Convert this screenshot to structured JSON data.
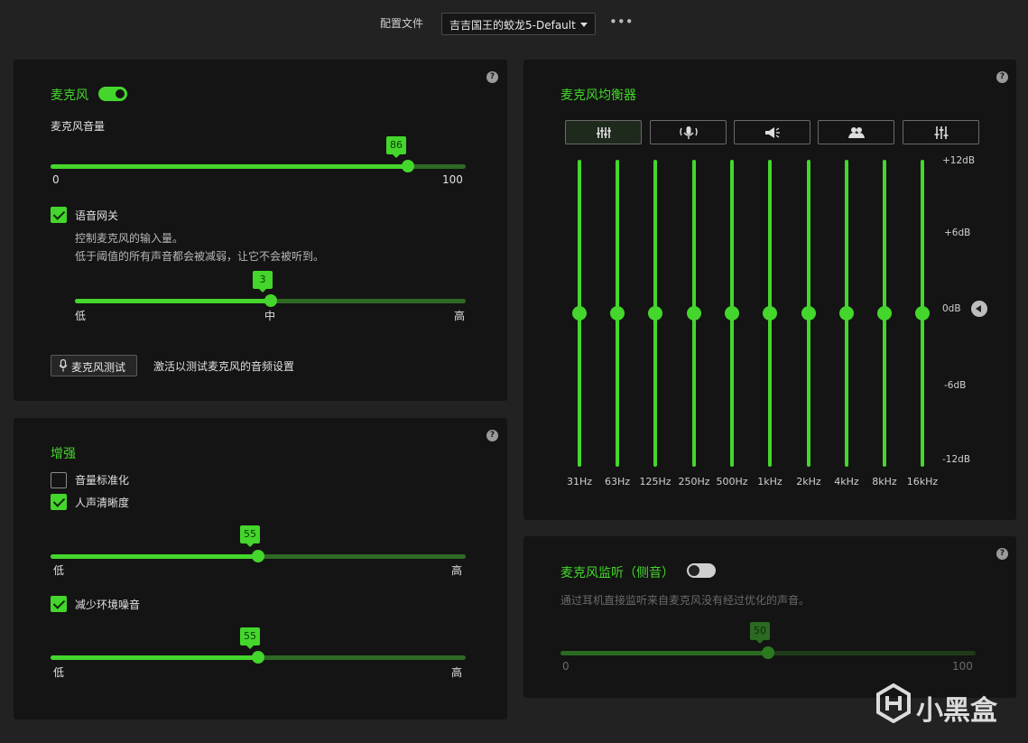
{
  "header": {
    "profile_label": "配置文件",
    "profile_value": "吉吉国王的蛟龙5-Default",
    "more": "•••"
  },
  "mic_panel": {
    "title": "麦克风",
    "toggle_on": true,
    "volume_label": "麦克风音量",
    "volume": {
      "value": "86",
      "fraction": 0.86,
      "min": "0",
      "max": "100"
    },
    "voice_gate": {
      "label": "语音网关",
      "checked": true,
      "desc1": "控制麦克风的输入量。",
      "desc2": "低于阈值的所有声音都会被减弱，让它不会被听到。",
      "value": "3",
      "fraction": 0.5,
      "low": "低",
      "mid": "中",
      "high": "高"
    },
    "test_button": "麦克风测试",
    "test_hint": "激活以测试麦克风的音频设置",
    "help": "?"
  },
  "enhance_panel": {
    "title": "增强",
    "normalize": {
      "label": "音量标准化",
      "checked": false
    },
    "clarity": {
      "label": "人声清晰度",
      "checked": true,
      "value": "55",
      "fraction": 0.5,
      "low": "低",
      "high": "高"
    },
    "noise": {
      "label": "减少环境噪音",
      "checked": true,
      "value": "55",
      "fraction": 0.5,
      "low": "低",
      "high": "高"
    },
    "help": "?"
  },
  "eq_panel": {
    "title": "麦克风均衡器",
    "presets": [
      "eq-sliders-icon",
      "broadcast-mic-icon",
      "megaphone-icon",
      "people-icon",
      "custom-eq-icon"
    ],
    "active_preset": 0,
    "bands": [
      {
        "label": "31Hz",
        "db": 0
      },
      {
        "label": "63Hz",
        "db": 0
      },
      {
        "label": "125Hz",
        "db": 0
      },
      {
        "label": "250Hz",
        "db": 0
      },
      {
        "label": "500Hz",
        "db": 0
      },
      {
        "label": "1kHz",
        "db": 0
      },
      {
        "label": "2kHz",
        "db": 0
      },
      {
        "label": "4kHz",
        "db": 0
      },
      {
        "label": "8kHz",
        "db": 0
      },
      {
        "label": "16kHz",
        "db": 0
      }
    ],
    "db_labels": [
      "+12dB",
      "+6dB",
      "0dB",
      "-6dB",
      "-12dB"
    ],
    "help": "?"
  },
  "sidetone_panel": {
    "title": "麦克风监听（侧音）",
    "toggle_on": false,
    "desc": "通过耳机直接监听来自麦克风没有经过优化的声音。",
    "value": "50",
    "fraction": 0.5,
    "min": "0",
    "max": "100",
    "help": "?"
  },
  "watermark": {
    "text": "小黑盒"
  },
  "colors": {
    "accent": "#44d62c",
    "panel": "#141414",
    "background": "#222222"
  }
}
